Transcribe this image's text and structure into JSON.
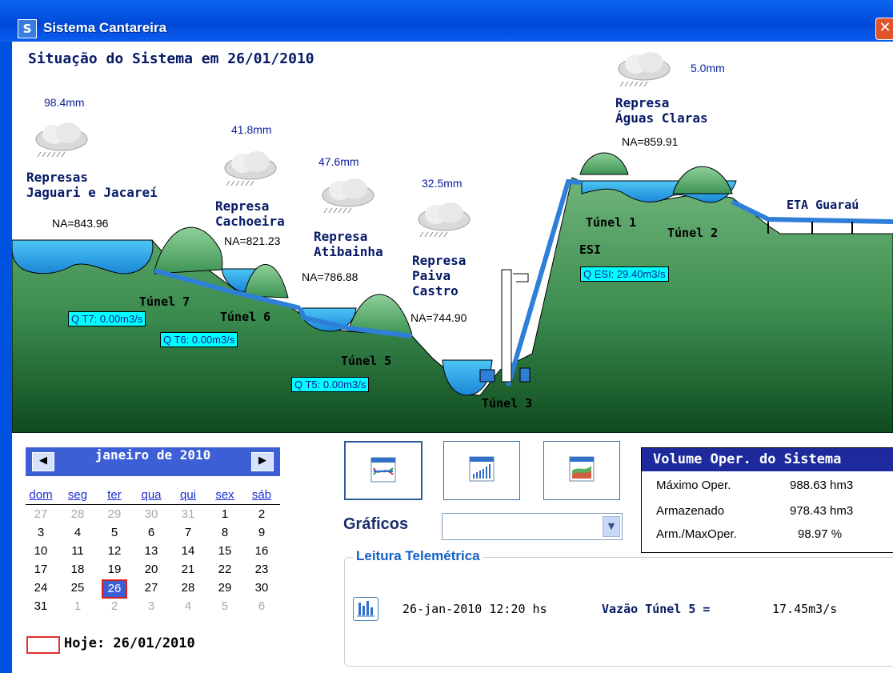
{
  "window": {
    "title": "Sistema Cantareira",
    "icon": "app-logo-icon",
    "close_icon": "close-icon"
  },
  "scene": {
    "heading": "Situação do Sistema em 26/01/2010",
    "reservoirs": [
      {
        "name_line1": "Represas",
        "name_line2": "Jaguari e Jacareí",
        "na": "NA=843.96",
        "rain": "98.4mm"
      },
      {
        "name_line1": "Represa",
        "name_line2": "Cachoeira",
        "na": "NA=821.23",
        "rain": "41.8mm"
      },
      {
        "name_line1": "Represa",
        "name_line2": "Atibainha",
        "na": "NA=786.88",
        "rain": "47.6mm"
      },
      {
        "name_line1": "Represa",
        "name_line2": "Paiva",
        "name_line3": "Castro",
        "na": "NA=744.90",
        "rain": "32.5mm"
      },
      {
        "name_line1": "Represa",
        "name_line2": "Águas Claras",
        "na": "NA=859.91",
        "rain": "5.0mm"
      }
    ],
    "tunnels": {
      "t7": "Túnel 7",
      "t6": "Túnel 6",
      "t5": "Túnel 5",
      "t3": "Túnel 3",
      "t1": "Túnel 1",
      "t2": "Túnel 2",
      "esi": "ESI",
      "eta": "ETA Guaraú"
    },
    "flows": {
      "t7": "Q T7: 0.00m3/s",
      "t6": "Q T6: 0.00m3/s",
      "t5": "Q T5: 0.00m3/s",
      "esi": "Q ESI: 29.40m3/s"
    },
    "colors": {
      "hill": "#6fb57a",
      "hill_dark": "#0e4a1e",
      "water": "#29a9e6",
      "pipe": "#2e7fd8"
    }
  },
  "calendar": {
    "month": "janeiro de 2010",
    "prev_icon": "arrow-left-icon",
    "next_icon": "arrow-right-icon",
    "weekdays": [
      "dom",
      "seg",
      "ter",
      "qua",
      "qui",
      "sex",
      "sáb"
    ],
    "weeks": [
      [
        "27",
        "28",
        "29",
        "30",
        "31",
        "1",
        "2"
      ],
      [
        "3",
        "4",
        "5",
        "6",
        "7",
        "8",
        "9"
      ],
      [
        "10",
        "11",
        "12",
        "13",
        "14",
        "15",
        "16"
      ],
      [
        "17",
        "18",
        "19",
        "20",
        "21",
        "22",
        "23"
      ],
      [
        "24",
        "25",
        "26",
        "27",
        "28",
        "29",
        "30"
      ],
      [
        "31",
        "1",
        "2",
        "3",
        "4",
        "5",
        "6"
      ]
    ],
    "selected": "26",
    "today": "Hoje: 26/01/2010"
  },
  "graphs": {
    "buttons": [
      "line-chart-icon",
      "bar-chart-icon",
      "area-chart-icon"
    ],
    "label": "Gráficos",
    "select_value": ""
  },
  "volume": {
    "title": "Volume  Oper. do Sistema",
    "rows": [
      {
        "label": "Máximo Oper.",
        "value": "988.63 hm3"
      },
      {
        "label": "Armazenado",
        "value": "978.43 hm3"
      },
      {
        "label": "Arm./MaxOper.",
        "value": "98.97 %"
      }
    ]
  },
  "telemetry": {
    "title": "Leitura Telemétrica",
    "icon": "chart-icon",
    "datetime": "26-jan-2010  12:20 hs",
    "label": "Vazão Túnel 5 =",
    "value": "17.45m3/s"
  }
}
